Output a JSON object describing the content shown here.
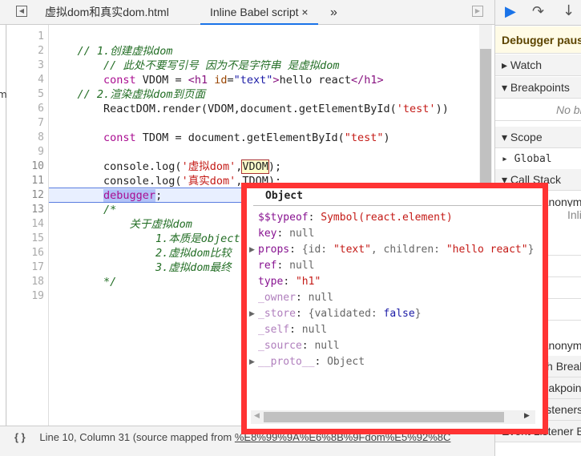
{
  "tabs": [
    {
      "label": "虚拟dom和真实dom.html"
    },
    {
      "label": "Inline Babel script",
      "close": "×"
    }
  ],
  "more_tabs": "»",
  "left_strip_text": "m",
  "code_lines": [
    [],
    [
      {
        "t": "    "
      },
      {
        "t": "// 1.创建虚拟dom",
        "c": "cm"
      }
    ],
    [
      {
        "t": "        "
      },
      {
        "t": "// 此处不要写引号 因为不是字符串 是虚拟dom",
        "c": "cm"
      }
    ],
    [
      {
        "t": "        "
      },
      {
        "t": "const",
        "c": "kw"
      },
      {
        "t": " VDOM = "
      },
      {
        "t": "<h1",
        "c": "tg"
      },
      {
        "t": " "
      },
      {
        "t": "id",
        "c": "at"
      },
      {
        "t": "="
      },
      {
        "t": "\"text\"",
        "c": "st"
      },
      {
        "t": ">",
        "c": "tg"
      },
      {
        "t": "hello react"
      },
      {
        "t": "</h1>",
        "c": "tg"
      }
    ],
    [
      {
        "t": "    "
      },
      {
        "t": "// 2.渲染虚拟dom到页面",
        "c": "cm"
      }
    ],
    [
      {
        "t": "        ReactDOM.render(VDOM,document.getElementById("
      },
      {
        "t": "'test'",
        "c": "str"
      },
      {
        "t": "))"
      }
    ],
    [],
    [
      {
        "t": "        "
      },
      {
        "t": "const",
        "c": "kw"
      },
      {
        "t": " TDOM = document.getElementById("
      },
      {
        "t": "\"test\"",
        "c": "str"
      },
      {
        "t": ")"
      }
    ],
    [],
    [
      {
        "t": "        console.log("
      },
      {
        "t": "'虚拟dom'",
        "c": "str"
      },
      {
        "t": ","
      },
      {
        "t": "VDOM",
        "c": "hl"
      },
      {
        "t": ");"
      }
    ],
    [
      {
        "t": "        console.log("
      },
      {
        "t": "'真实dom'",
        "c": "str"
      },
      {
        "t": ",TDOM);"
      }
    ],
    [
      {
        "t": "        "
      },
      {
        "t": "debugger",
        "c": "kw dbg"
      },
      {
        "t": ";"
      }
    ],
    [
      {
        "t": "        "
      },
      {
        "t": "/*",
        "c": "cm"
      }
    ],
    [
      {
        "t": "            "
      },
      {
        "t": "关于虚拟dom",
        "c": "cm"
      }
    ],
    [
      {
        "t": "                "
      },
      {
        "t": "1.本质是object",
        "c": "cm"
      }
    ],
    [
      {
        "t": "                "
      },
      {
        "t": "2.虚拟dom比较",
        "c": "cm"
      }
    ],
    [
      {
        "t": "                "
      },
      {
        "t": "3.虚拟dom最终",
        "c": "cm"
      }
    ],
    [
      {
        "t": "        "
      },
      {
        "t": "*/",
        "c": "cm"
      }
    ],
    []
  ],
  "right_panel": {
    "rows": [
      "Debugger paused",
      "▸ Watch",
      "▾ Breakpoints",
      "No breakpoints",
      "▾ Scope",
      "▸ Global",
      "▾ Call Stack",
      "(anonymous)",
      "Inline Babel script",
      "",
      "",
      "",
      "",
      "",
      "(anonymous)",
      "XHR/fetch Breakpoints",
      "DOM Breakpoints",
      "Global Listeners",
      "Event Listener Breakpoints"
    ]
  },
  "popup": {
    "title": "Object",
    "rows": [
      {
        "k": "$$typeof",
        "v": "Symbol(react.element)",
        "vc": "ps"
      },
      {
        "k": "key",
        "v": "null",
        "vc": "pn"
      },
      {
        "k": "props",
        "v": "{id: \"text\", children: \"hello react\"}",
        "vc": "pn",
        "expand": true
      },
      {
        "k": "ref",
        "v": "null",
        "vc": "pn"
      },
      {
        "k": "type",
        "v": "\"h1\"",
        "vc": "ps"
      },
      {
        "k": "_owner",
        "v": "null",
        "vc": "pn",
        "dim": true
      },
      {
        "k": "_store",
        "v": "{validated: false}",
        "vc": "pn",
        "expand": true,
        "dim": true
      },
      {
        "k": "_self",
        "v": "null",
        "vc": "pn",
        "dim": true
      },
      {
        "k": "_source",
        "v": "null",
        "vc": "pn",
        "dim": true
      },
      {
        "k": "__proto__",
        "v": "Object",
        "vc": "pn",
        "expand": true,
        "dim": true
      }
    ]
  },
  "status": {
    "icon": "{ }",
    "text": "Line 10, Column 31  (source mapped from ",
    "link": "%E8%99%9A%E6%8B%9Fdom%E5%92%8C"
  }
}
